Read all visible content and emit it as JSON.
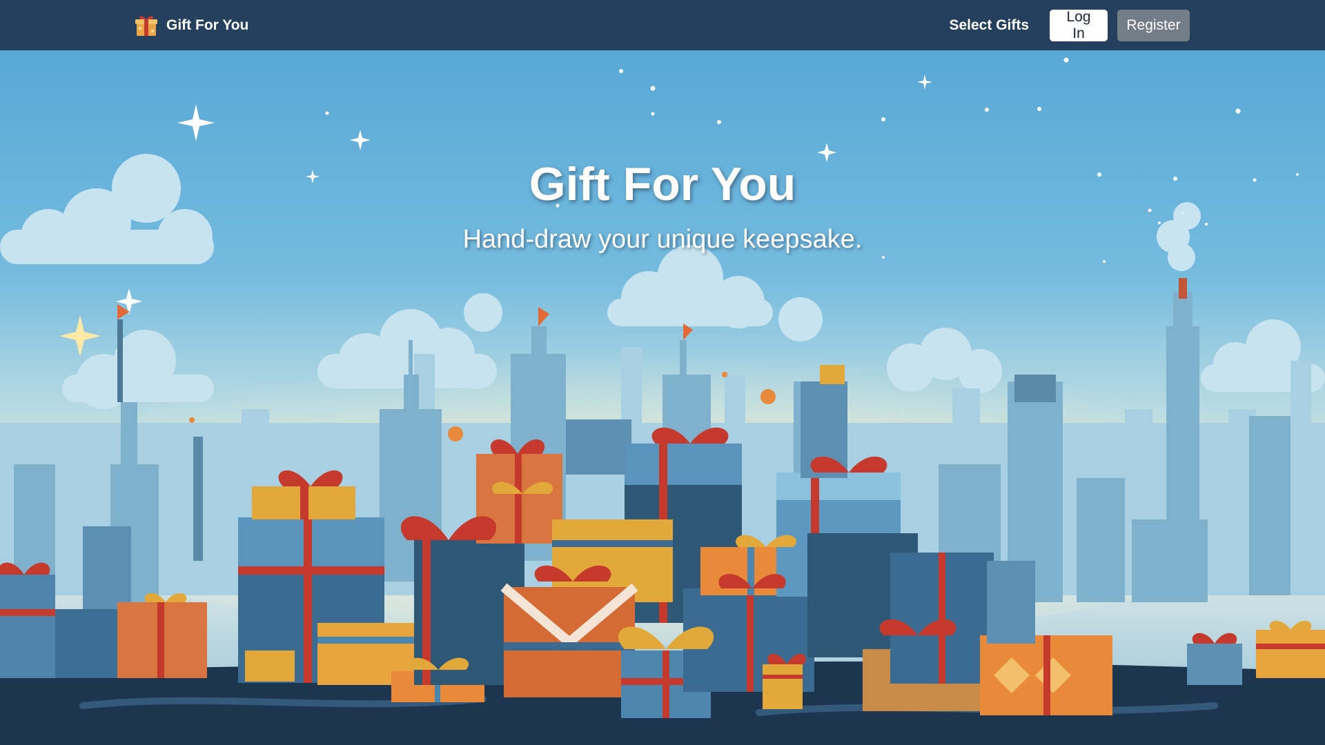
{
  "nav": {
    "brand_icon": "gift-icon",
    "brand_name": "Gift For You",
    "select_gifts": "Select Gifts",
    "login": "Log In",
    "register": "Register"
  },
  "hero": {
    "title": "Gift For You",
    "subtitle": "Hand-draw your unique keepsake.",
    "illustration": "gift-city-illustration"
  },
  "colors": {
    "navbar_bg": "#24405c",
    "sky_top": "#58a8d6",
    "sky_horizon": "#f6e6b4",
    "ground": "#1e3550",
    "login_bg": "#ffffff",
    "register_bg": "#737d88",
    "gift_orange": "#e07a3c",
    "gift_blue": "#3f6f96",
    "ribbon_red": "#c63a2e",
    "ribbon_gold": "#e2a93a"
  }
}
